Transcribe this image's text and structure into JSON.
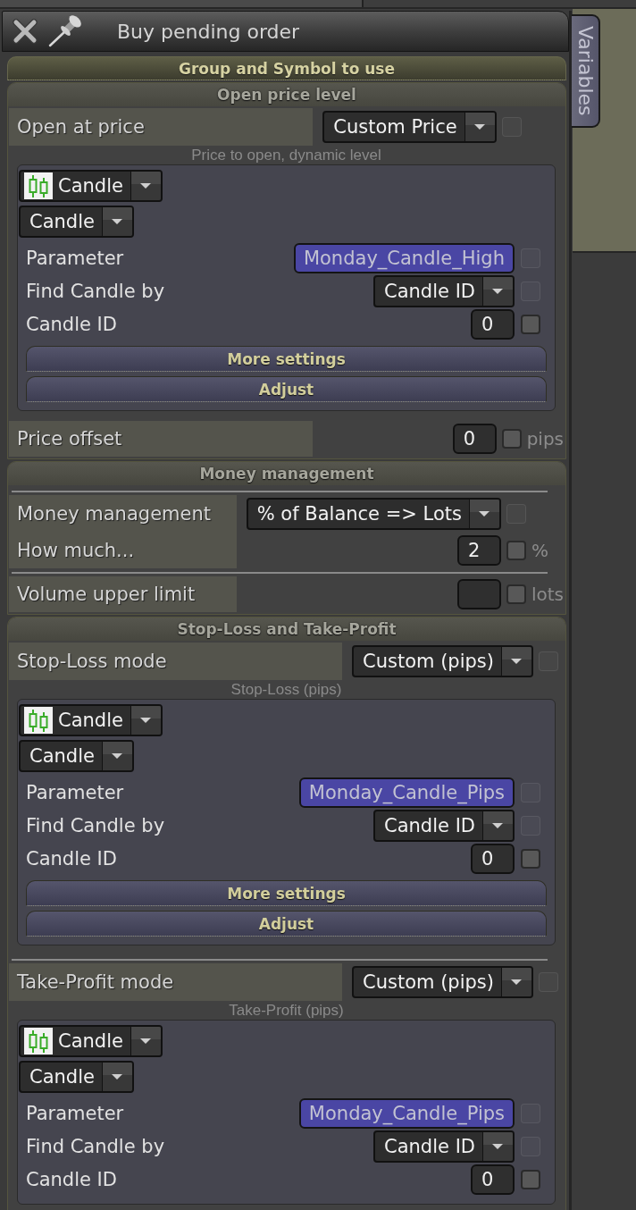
{
  "window": {
    "title": "Buy pending order",
    "side_tab": "Variables"
  },
  "sections": [
    {
      "title": "Group and Symbol to use",
      "expanded": false
    },
    {
      "title": "Open price level",
      "expanded": true,
      "rows": [
        {
          "kind": "dropdown",
          "label": "Open at price",
          "value": "Custom Price",
          "checkbox": {
            "checked": false,
            "disabled": true
          }
        },
        {
          "kind": "caption",
          "text": "Price to open, dynamic level"
        },
        {
          "kind": "panel",
          "rows": [
            {
              "kind": "icon_select",
              "value": "Candle"
            },
            {
              "kind": "select",
              "value": "Candle"
            },
            {
              "kind": "variable",
              "label": "Parameter",
              "value": "Monday_Candle_High",
              "checkbox": {
                "checked": false,
                "disabled": true
              }
            },
            {
              "kind": "dropdown",
              "label": "Find Candle by",
              "value": "Candle ID",
              "checkbox": {
                "checked": false,
                "disabled": true
              }
            },
            {
              "kind": "input",
              "label": "Candle ID",
              "value": "0",
              "checkbox": {
                "checked": false,
                "disabled": false
              }
            },
            {
              "kind": "button",
              "label": "More settings"
            },
            {
              "kind": "button",
              "label": "Adjust"
            }
          ]
        },
        {
          "kind": "input",
          "label": "Price offset",
          "value": "0",
          "checkbox": {
            "checked": false,
            "disabled": false
          },
          "unit": "pips"
        }
      ]
    },
    {
      "title": "Money management",
      "expanded": true,
      "rows": [
        {
          "kind": "divider"
        },
        {
          "kind": "dropdown",
          "label": "Money management",
          "value": "% of Balance => Lots",
          "checkbox": {
            "checked": false,
            "disabled": true
          }
        },
        {
          "kind": "input",
          "label": "How much...",
          "value": "2",
          "checkbox": {
            "checked": false,
            "disabled": false
          },
          "unit": "%"
        },
        {
          "kind": "divider"
        },
        {
          "kind": "input",
          "label": "Volume upper limit",
          "checkbox": {
            "checked": false,
            "disabled": false
          },
          "unit": "lots"
        }
      ]
    },
    {
      "title": "Stop-Loss and Take-Profit",
      "expanded": true,
      "rows": [
        {
          "kind": "dropdown",
          "label": "Stop-Loss mode",
          "value": "Custom (pips)",
          "checkbox": {
            "checked": false,
            "disabled": true
          }
        },
        {
          "kind": "caption",
          "text": "Stop-Loss (pips)"
        },
        {
          "kind": "panel",
          "rows": [
            {
              "kind": "icon_select",
              "value": "Candle"
            },
            {
              "kind": "select",
              "value": "Candle"
            },
            {
              "kind": "variable",
              "label": "Parameter",
              "value": "Monday_Candle_Pips",
              "checkbox": {
                "checked": false,
                "disabled": true
              }
            },
            {
              "kind": "dropdown",
              "label": "Find Candle by",
              "value": "Candle ID",
              "checkbox": {
                "checked": false,
                "disabled": true
              }
            },
            {
              "kind": "input",
              "label": "Candle ID",
              "value": "0",
              "checkbox": {
                "checked": false,
                "disabled": false
              }
            },
            {
              "kind": "button",
              "label": "More settings"
            },
            {
              "kind": "button",
              "label": "Adjust"
            }
          ]
        },
        {
          "kind": "divider"
        },
        {
          "kind": "dropdown",
          "label": "Take-Profit mode",
          "value": "Custom (pips)",
          "checkbox": {
            "checked": false,
            "disabled": true
          }
        },
        {
          "kind": "caption",
          "text": "Take-Profit (pips)"
        },
        {
          "kind": "panel",
          "rows": [
            {
              "kind": "icon_select",
              "value": "Candle"
            },
            {
              "kind": "select",
              "value": "Candle"
            },
            {
              "kind": "variable",
              "label": "Parameter",
              "value": "Monday_Candle_Pips",
              "checkbox": {
                "checked": false,
                "disabled": true
              }
            },
            {
              "kind": "dropdown",
              "label": "Find Candle by",
              "value": "Candle ID",
              "checkbox": {
                "checked": false,
                "disabled": true
              }
            },
            {
              "kind": "input",
              "label": "Candle ID",
              "value": "0",
              "checkbox": {
                "checked": false,
                "disabled": false
              }
            }
          ]
        }
      ]
    }
  ]
}
